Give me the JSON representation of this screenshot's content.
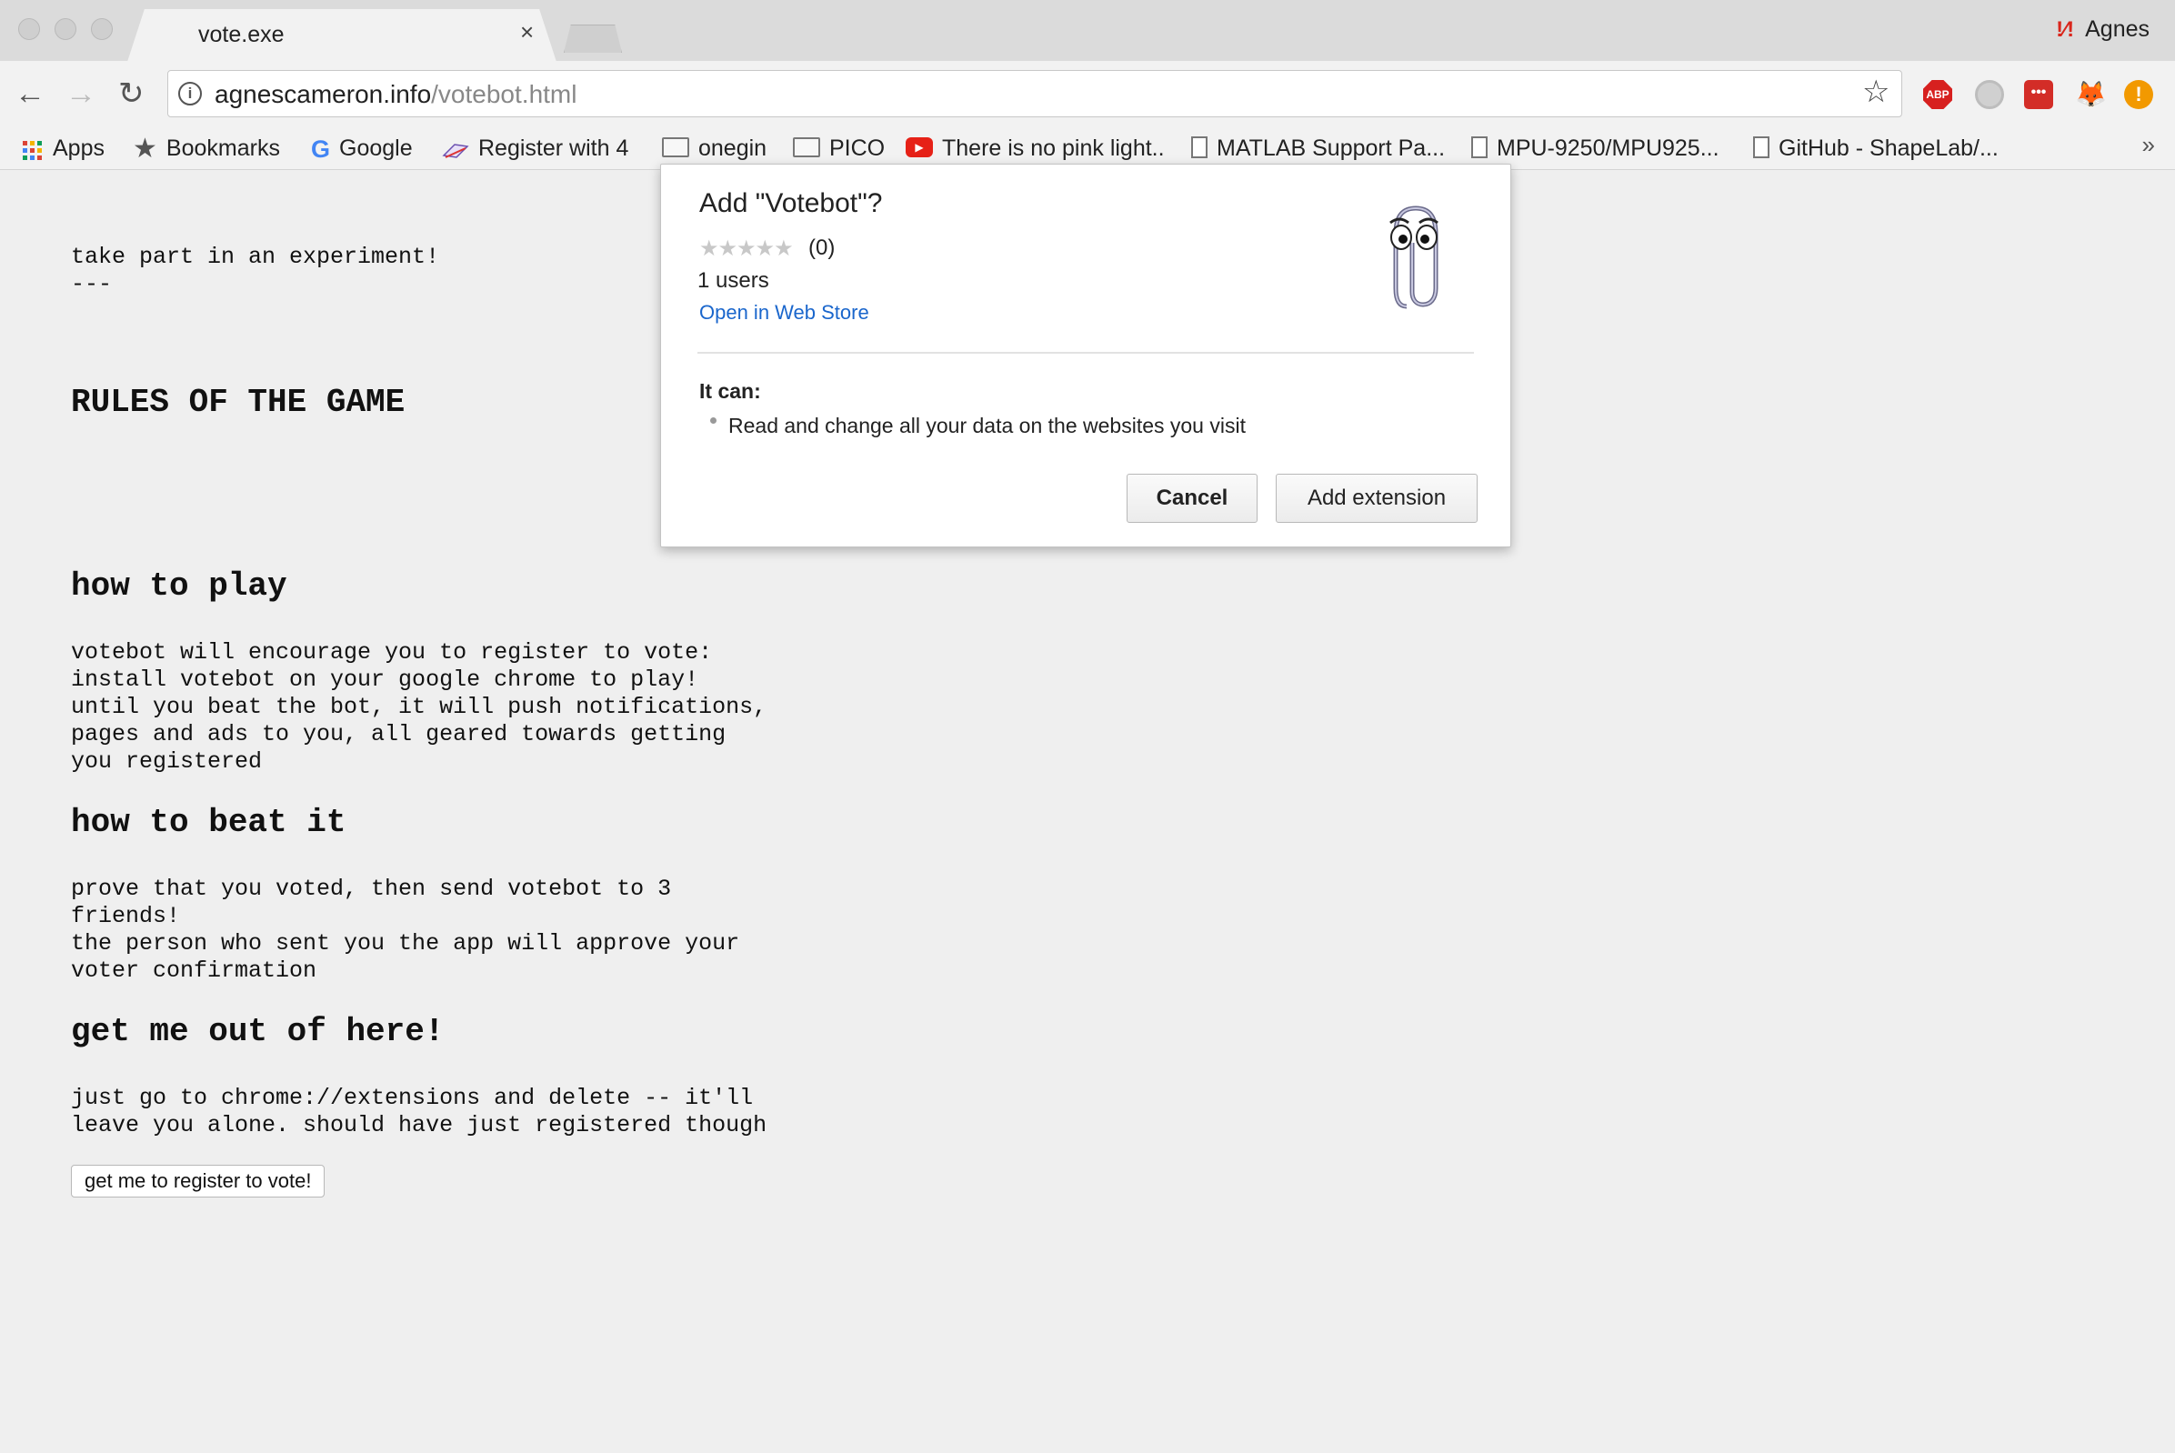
{
  "window": {
    "tab_title": "vote.exe",
    "tab_close": "×",
    "profile_name": "Agnes",
    "profile_icon": "!⁄!"
  },
  "toolbar": {
    "url_host": "agnescameron.info",
    "url_path": "/votebot.html",
    "back_icon": "←",
    "forward_icon": "→",
    "reload_icon": "↻",
    "info_icon": "i",
    "bookmark_star_icon": "☆",
    "extensions": {
      "abp_label": "ABP",
      "lastpass_label": "•••",
      "fox_icon": "🦊",
      "warning_label": "!"
    }
  },
  "bookmarks": {
    "items": [
      {
        "label": "Apps",
        "icon": "apps-grid-icon"
      },
      {
        "label": "Bookmarks",
        "icon": "star-icon"
      },
      {
        "label": "Google",
        "icon": "google-icon"
      },
      {
        "label": "Register with 4",
        "icon": "register-icon"
      },
      {
        "label": "onegin",
        "icon": "folder-icon"
      },
      {
        "label": "PICO",
        "icon": "folder-icon"
      },
      {
        "label": "There is no pink light..",
        "icon": "youtube-icon"
      },
      {
        "label": "MATLAB Support Pa...",
        "icon": "page-icon"
      },
      {
        "label": "MPU-9250/MPU925...",
        "icon": "page-icon"
      },
      {
        "label": "GitHub - ShapeLab/...",
        "icon": "page-icon"
      }
    ],
    "more_icon": "»",
    "star_glyph": "★",
    "google_glyph": "G"
  },
  "page": {
    "intro": "take part in an experiment!\n---",
    "rules_heading": "RULES OF THE GAME",
    "how_to_play_heading": "how to play",
    "how_to_play_text": "votebot will encourage you to register to vote:\ninstall votebot on your google chrome to play!\nuntil you beat the bot, it will push notifications,\npages and ads to you, all geared towards getting\nyou registered",
    "how_to_beat_heading": "how to beat it",
    "how_to_beat_text": "prove that you voted, then send votebot to 3\nfriends!\nthe person who sent you the app will approve your\nvoter confirmation",
    "get_out_heading": "get me out of here!",
    "get_out_text": "just go to chrome://extensions and delete -- it'll\nleave you alone. should have just registered though",
    "register_button": "get me to register to vote!"
  },
  "dialog": {
    "title": "Add \"Votebot\"?",
    "stars": "★★★★★",
    "rating_count": "(0)",
    "users": "1 users",
    "store_link": "Open in Web Store",
    "it_can": "It can:",
    "permission": "Read and change all your data on the websites you visit",
    "cancel_label": "Cancel",
    "add_label": "Add extension"
  },
  "colors": {
    "link": "#1a66cc",
    "page_bg": "#efefef",
    "abp_red": "#d7201f",
    "youtube_red": "#e62117"
  }
}
